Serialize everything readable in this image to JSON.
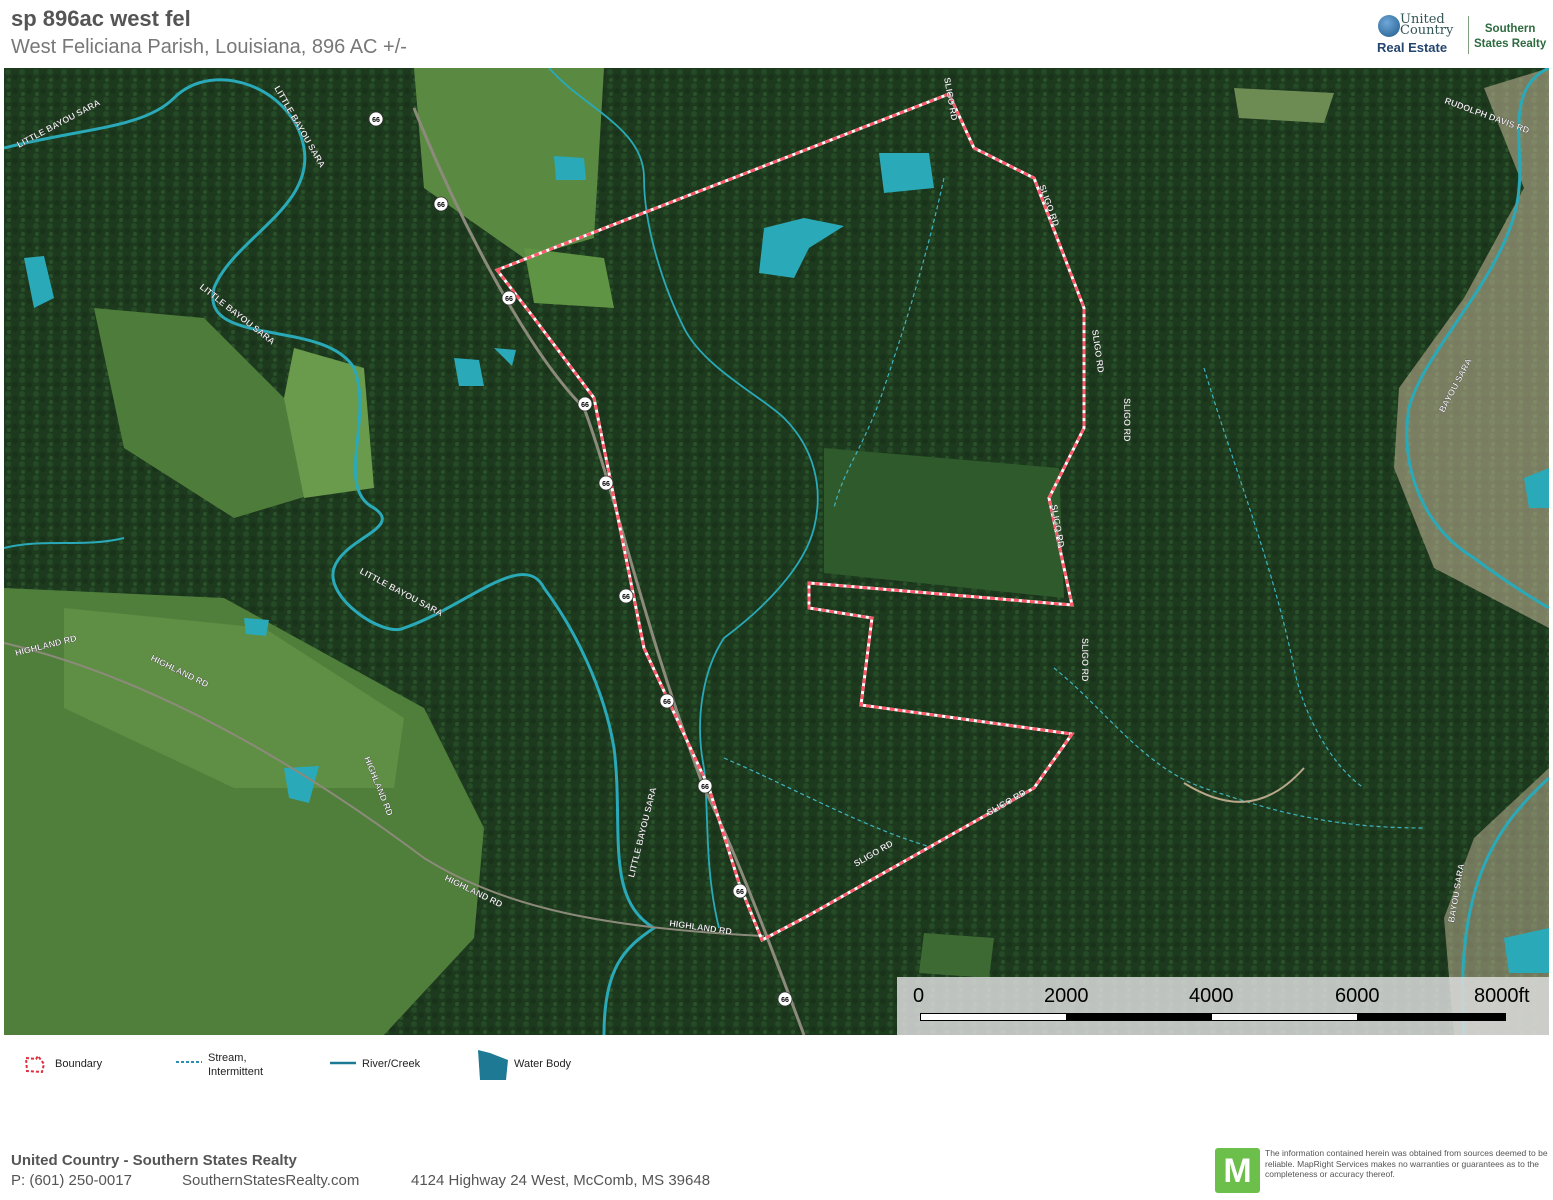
{
  "header": {
    "title": "sp 896ac west fel",
    "subtitle": "West Feliciana Parish, Louisiana, 896 AC +/-"
  },
  "logo": {
    "line1": "United",
    "line2": "Country",
    "line3": "Real Estate",
    "partner1": "Southern",
    "partner2": "States Realty"
  },
  "map": {
    "road_labels": [
      "LITTLE BAYOU SARA",
      "LITTLE BAYOU SARA",
      "LITTLE BAYOU SARA",
      "LITTLE BAYOU SARA",
      "LITTLE BAYOU SARA",
      "SLIGO RD",
      "SLIGO RD",
      "SLIGO RD",
      "SLIGO RD",
      "SLIGO RD",
      "SLIGO RD",
      "SLIGO RD",
      "SLIGO RD",
      "HIGHLAND RD",
      "HIGHLAND RD",
      "HIGHLAND RD",
      "HIGHLAND RD",
      "HIGHLAND RD",
      "RUDOLPH DAVIS RD",
      "BAYOU SARA",
      "BAYOU SARA"
    ],
    "highway_shield": "66",
    "colors": {
      "forest": "#1d3a1e",
      "field": "#4a7a3a",
      "water": "#2aa9b8",
      "boundary": "#ff6b7a"
    }
  },
  "scale": {
    "ticks": [
      "0",
      "2000",
      "4000",
      "6000",
      "8000ft"
    ]
  },
  "legend": {
    "boundary": "Boundary",
    "stream": "Stream,",
    "stream2": "Intermittent",
    "river": "River/Creek",
    "water": "Water Body"
  },
  "footer": {
    "company": "United Country - Southern States Realty",
    "phone": "P: (601) 250-0017",
    "website": "SouthernStatesRealty.com",
    "address": "4124 Highway 24 West, McComb, MS 39648",
    "mr_letter": "M",
    "disclaimer": "The information contained herein was obtained from sources deemed to be reliable. MapRight Services makes no warranties or guarantees as to the completeness or accuracy thereof."
  }
}
